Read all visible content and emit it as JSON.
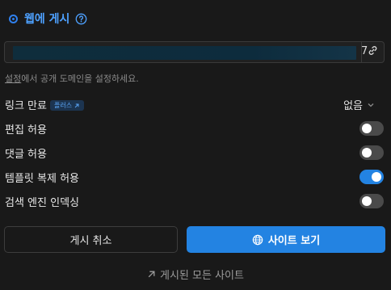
{
  "header": {
    "title": "웹에 게시",
    "icon": "help-circle-icon",
    "accent_color": "#2f80ed"
  },
  "url_field": {
    "visible_tail": "7",
    "link_icon": "link-icon"
  },
  "hint": {
    "link_text": "설정",
    "rest_text": "에서 공개 도메인을 설정하세요."
  },
  "link_expiry": {
    "label": "링크 만료",
    "badge": "플러스",
    "value": "없음"
  },
  "toggles": [
    {
      "label": "편집 허용",
      "on": false
    },
    {
      "label": "댓글 허용",
      "on": false
    },
    {
      "label": "템플릿 복제 허용",
      "on": true
    },
    {
      "label": "검색 엔진 인덱싱",
      "on": false
    }
  ],
  "buttons": {
    "cancel": "게시 취소",
    "view_site": "사이트 보기"
  },
  "footer": {
    "all_sites": "게시된 모든 사이트"
  }
}
